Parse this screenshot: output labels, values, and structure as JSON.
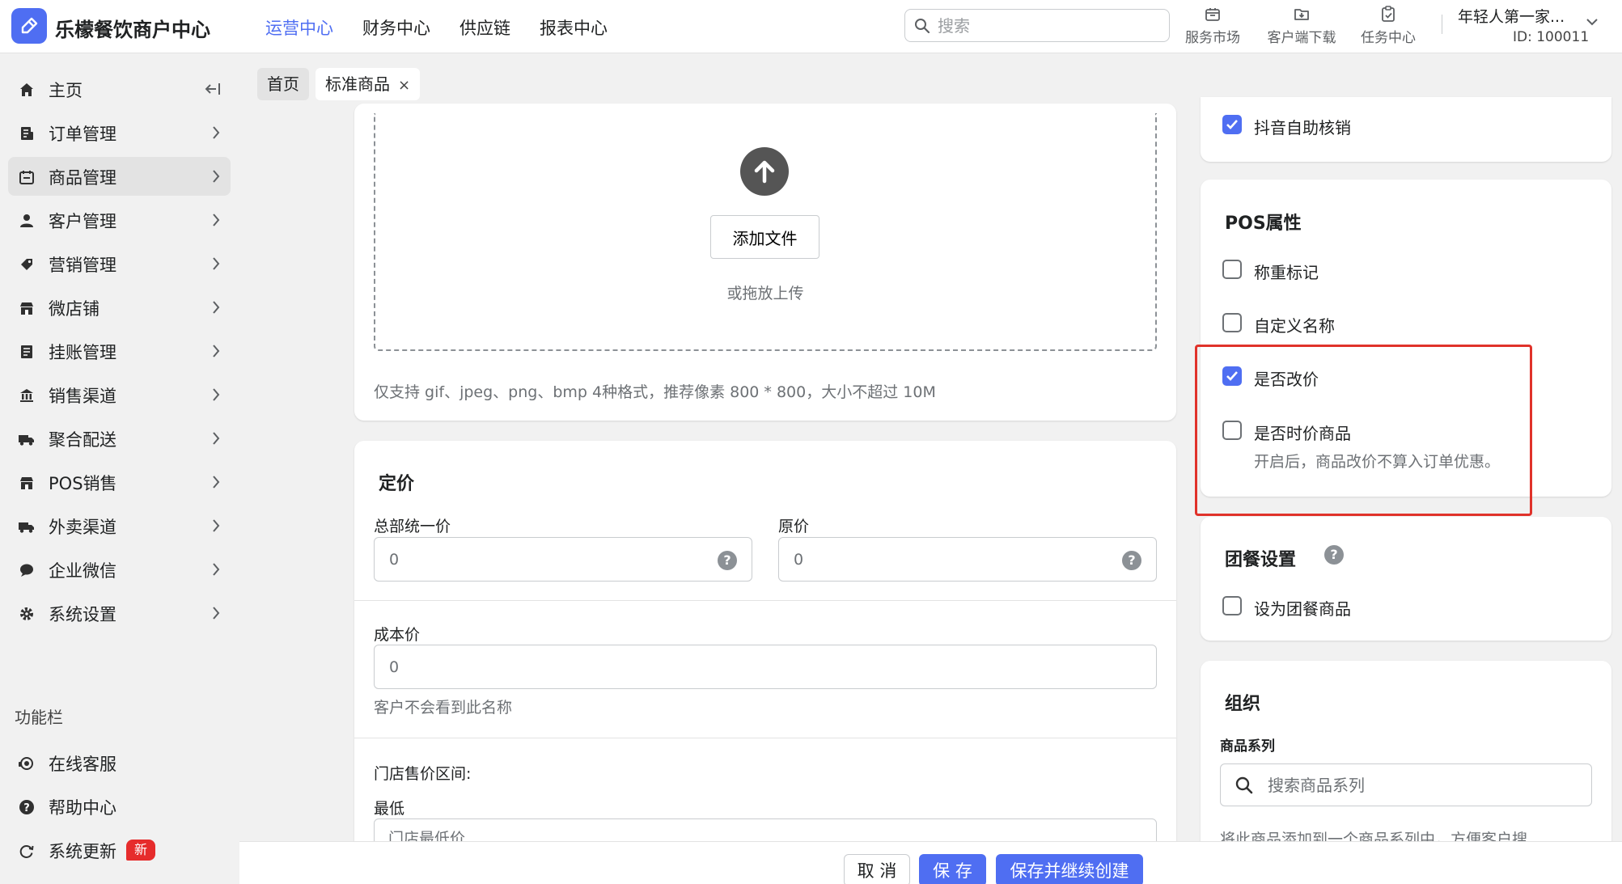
{
  "header": {
    "app_title": "乐檬餐饮商户中心",
    "nav": [
      {
        "label": "运营中心",
        "active": true
      },
      {
        "label": "财务中心"
      },
      {
        "label": "供应链"
      },
      {
        "label": "报表中心"
      }
    ],
    "search_placeholder": "搜索",
    "tools": [
      {
        "label": "服务市场",
        "icon": "store-icon"
      },
      {
        "label": "客户端下载",
        "icon": "download-icon"
      },
      {
        "label": "任务中心",
        "icon": "clipboard-icon"
      }
    ],
    "account": {
      "name": "年轻人第一家...",
      "id": "ID: 100011"
    }
  },
  "sidebar": {
    "items": [
      {
        "label": "主页",
        "icon": "home-icon"
      },
      {
        "label": "订单管理",
        "icon": "order-icon"
      },
      {
        "label": "商品管理",
        "icon": "product-icon",
        "active": true
      },
      {
        "label": "客户管理",
        "icon": "person-icon"
      },
      {
        "label": "营销管理",
        "icon": "tag-icon"
      },
      {
        "label": "微店铺",
        "icon": "shop-icon"
      },
      {
        "label": "挂账管理",
        "icon": "ledger-icon"
      },
      {
        "label": "销售渠道",
        "icon": "bank-icon"
      },
      {
        "label": "聚合配送",
        "icon": "truck-icon"
      },
      {
        "label": "POS销售",
        "icon": "pos-store-icon"
      },
      {
        "label": "外卖渠道",
        "icon": "delivery-truck-icon"
      },
      {
        "label": "企业微信",
        "icon": "chat-icon"
      },
      {
        "label": "系统设置",
        "icon": "gear-icon"
      }
    ],
    "section_label": "功能栏",
    "utility_items": [
      {
        "label": "在线客服",
        "icon": "support-icon"
      },
      {
        "label": "帮助中心",
        "icon": "help-icon"
      },
      {
        "label": "系统更新",
        "icon": "refresh-icon",
        "badge": "新"
      }
    ]
  },
  "tabs": [
    {
      "label": "首页"
    },
    {
      "label": "标准商品",
      "closable": true,
      "close": "×"
    }
  ],
  "media": {
    "add_file_label": "添加文件",
    "drag_hint": "或拖放上传",
    "format_note": "仅支持 gif、jpeg、png、bmp 4种格式，推荐像素 800 * 800，大小不超过 10M"
  },
  "pricing": {
    "title": "定价",
    "unified_price": {
      "label": "总部统一价",
      "value": "0"
    },
    "original_price": {
      "label": "原价",
      "value": "0"
    },
    "cost_price": {
      "label": "成本价",
      "value": "0",
      "help": "客户不会看到此名称"
    },
    "store_range_label": "门店售价区间:",
    "min_label": "最低",
    "min_placeholder": "门店最低价"
  },
  "right_panel": {
    "douyin": {
      "label": "抖音自助核销",
      "checked": true
    },
    "pos": {
      "title": "POS属性",
      "options": [
        {
          "label": "称重标记",
          "checked": false
        },
        {
          "label": "自定义名称",
          "checked": false
        },
        {
          "label": "是否改价",
          "checked": true
        },
        {
          "label": "是否时价商品",
          "checked": false,
          "help": "开启后，商品改价不算入订单优惠。"
        }
      ]
    },
    "group_meal": {
      "title": "团餐设置",
      "option": {
        "label": "设为团餐商品",
        "checked": false
      }
    },
    "organization": {
      "title": "组织",
      "series_label": "商品系列",
      "series_placeholder": "搜索商品系列",
      "series_help": "将此商品添加到一个商品系列中，方便客户搜"
    }
  },
  "footer": {
    "cancel": "取 消",
    "save": "保 存",
    "save_continue": "保存并继续创建"
  },
  "colors": {
    "accent": "#4f6ef2",
    "highlight": "#e0322a",
    "badge": "#e62c2c"
  }
}
